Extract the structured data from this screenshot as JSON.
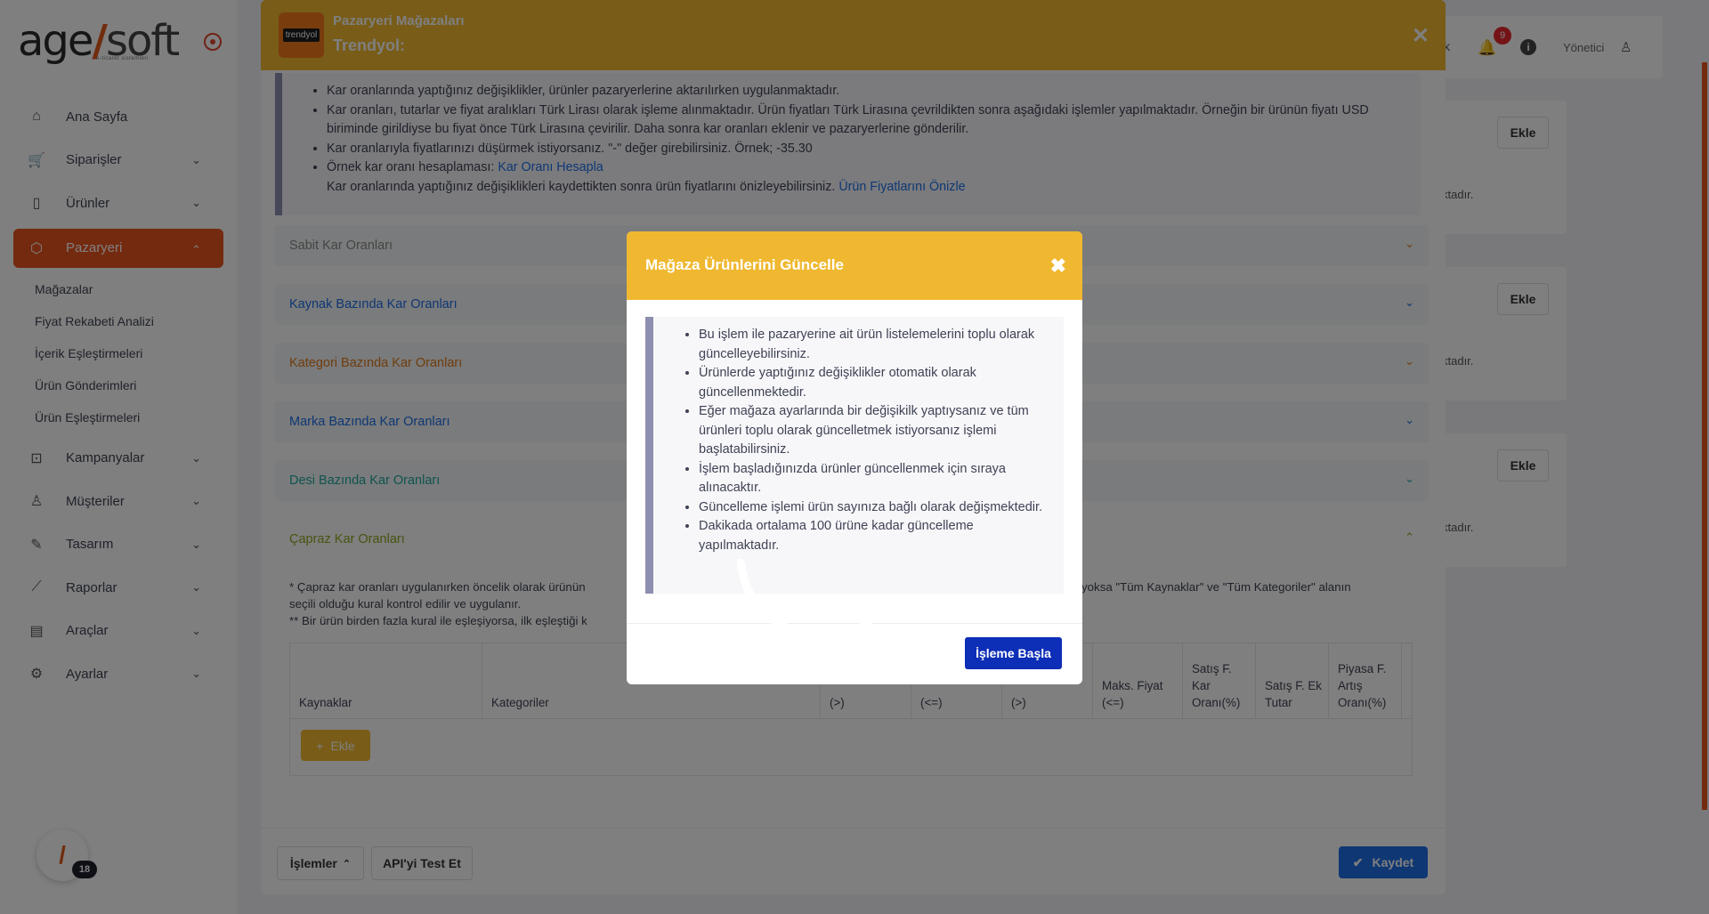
{
  "app": {
    "logo_main": "age",
    "logo_slash": "/",
    "logo_soft": "soft",
    "logo_sub": "e-ticaret sistemleri"
  },
  "sidebar": {
    "items": [
      {
        "label": "Ana Sayfa",
        "icon": "home-icon"
      },
      {
        "label": "Siparişler",
        "icon": "cart-icon"
      },
      {
        "label": "Ürünler",
        "icon": "book-icon"
      },
      {
        "label": "Pazaryeri",
        "icon": "box-icon",
        "active": true
      },
      {
        "label": "Kampanyalar",
        "icon": "gift-icon"
      },
      {
        "label": "Müşteriler",
        "icon": "user-icon"
      },
      {
        "label": "Tasarım",
        "icon": "edit-icon"
      },
      {
        "label": "Raporlar",
        "icon": "chart-icon"
      },
      {
        "label": "Araçlar",
        "icon": "clipboard-icon"
      },
      {
        "label": "Ayarlar",
        "icon": "settings-icon"
      }
    ],
    "submenu": [
      "Mağazalar",
      "Fiyat Rekabeti Analizi",
      "İçerik Eşleştirmeleri",
      "Ürün Gönderimleri",
      "Ürün Eşleştirmeleri"
    ],
    "help_badge": "18"
  },
  "topbar": {
    "partial_text": "k",
    "notification_count": "9",
    "info_glyph": "i",
    "user": "Yönetici"
  },
  "background_cards": {
    "ekle_label": "Ekle",
    "partial_text": "ktadır."
  },
  "store_modal": {
    "logo_text": "trendyol",
    "title": "Pazaryeri Mağazaları",
    "subtitle": "Trendyol:",
    "notes": [
      "Kar oranlarında yaptığınız değişiklikler, ürünler pazaryerlerine aktarılırken uygulanmaktadır.",
      "Kar oranları, tutarlar ve fiyat aralıkları Türk Lirası olarak işleme alınmaktadır. Ürün fiyatları Türk Lirasına çevrildikten sonra aşağıdaki işlemler yapılmaktadır. Örneğin bir ürünün fiyatı USD biriminde girildiyse bu fiyat önce Türk Lirasına çevirilir. Daha sonra kar oranları eklenir ve pazaryerlerine gönderilir.",
      "Kar oranlarıyla fiyatlarınızı düşürmek istiyorsanız. \"-\" değer girebilirsiniz. Örnek; -35.30"
    ],
    "example_prefix": "Örnek kar oranı hesaplaması: ",
    "example_link": "Kar Oranı Hesapla",
    "preview_prefix": "Kar oranlarında yaptığınız değişiklikleri kaydettikten sonra ürün fiyatlarını önizleyebilirsiniz. ",
    "preview_link": "Ürün Fiyatlarını Önizle",
    "accordions": [
      {
        "label": "Sabit Kar Oranları",
        "color": "#8a8a8a"
      },
      {
        "label": "Kaynak Bazında Kar Oranları",
        "color": "#1d6ee8"
      },
      {
        "label": "Kategori Bazında Kar Oranları",
        "color": "#e07a1a"
      },
      {
        "label": "Marka Bazında Kar Oranları",
        "color": "#1d6ee8"
      },
      {
        "label": "Desi Bazında Kar Oranları",
        "color": "#1fa8a0"
      },
      {
        "label": "Çapraz Kar Oranları",
        "color": "#8ca81f"
      }
    ],
    "cross_text_line1a": "* Çapraz kar oranları uygulanırken öncelik olarak ürünün",
    "cross_text_line1b": "yoksa \"Tüm Kaynaklar\" ve \"Tüm Kategoriler\" alanın",
    "cross_text_line2": "seçili olduğu kural kontrol edilir ve uygulanır.",
    "cross_text_line3": "** Bir ürün birden fazla kural ile eşleşiyorsa, ilk eşleştiği k",
    "table_headers": [
      "Kaynaklar",
      "Kategoriler",
      "(>)",
      "(<=)",
      "(>)",
      "Maks. Fiyat (<=)",
      "Satış F. Kar Oranı(%)",
      "Satış F. Ek Tutar",
      "Piyasa F. Artış Oranı(%)"
    ],
    "add_label": "Ekle",
    "add_glyph": "+",
    "footer": {
      "actions": "İşlemler",
      "actions_caret": "⌃",
      "test_api": "API'yi Test Et",
      "save": "Kaydet",
      "save_glyph": "✔"
    }
  },
  "dialog": {
    "title": "Mağaza Ürünlerini Güncelle",
    "close_glyph": "✖",
    "notes": [
      "Bu işlem ile pazaryerine ait ürün listelemelerini toplu olarak güncelleyebilirsiniz.",
      "Ürünlerde yaptığınız değişiklikler otomatik olarak güncellenmektedir.",
      "Eğer mağaza ayarlarında bir değişikilk yaptıysanız ve tüm ürünleri toplu olarak güncelletmek istiyorsanız işlemi başlatabilirsiniz.",
      "İşlem başladığınızda ürünler güncellenmek için sıraya alınacaktır.",
      "Güncelleme işlemi ürün sayınıza bağlı olarak değişmektedir.",
      "Dakikada ortalama 100 ürüne kadar güncelleme yapılmaktadır."
    ],
    "start_button": "İşleme Başla"
  }
}
